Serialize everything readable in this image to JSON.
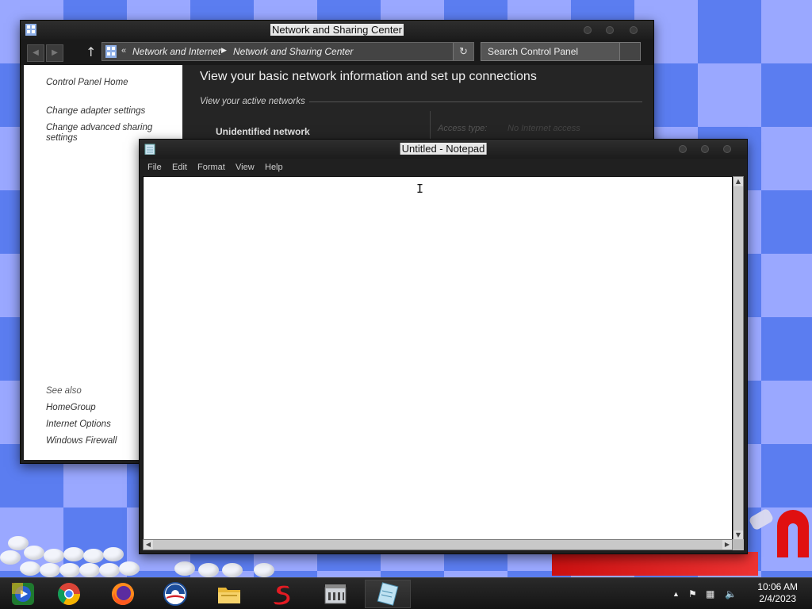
{
  "desktop": {},
  "network_window": {
    "title": "Network and Sharing Center",
    "address": {
      "crumb_prefix": "«",
      "crumb1": "Network and Internet",
      "crumb2": "Network and Sharing Center"
    },
    "search_placeholder": "Search Control Panel",
    "left_nav": {
      "home": "Control Panel Home",
      "adapter": "Change adapter settings",
      "advanced": "Change advanced sharing settings",
      "see_also": "See also",
      "homegroup": "HomeGroup",
      "internet_options": "Internet Options",
      "firewall": "Windows Firewall"
    },
    "heading": "View your basic network information and set up connections",
    "active_networks_label": "View your active networks",
    "network_name": "Unidentified network",
    "access_type_label": "Access type:",
    "access_type_value": "No Internet access"
  },
  "notepad": {
    "title": "Untitled - Notepad",
    "menu": [
      "File",
      "Edit",
      "Format",
      "View",
      "Help"
    ],
    "content": ""
  },
  "taskbar": {
    "apps": [
      {
        "name": "Windows Media Player"
      },
      {
        "name": "Google Chrome"
      },
      {
        "name": "Firefox"
      },
      {
        "name": "Obama Logo"
      },
      {
        "name": "File Explorer"
      },
      {
        "name": "S App"
      },
      {
        "name": "Control Panel"
      },
      {
        "name": "Notepad"
      }
    ],
    "clock": {
      "time": "10:06 AM",
      "date": "2/4/2023"
    }
  }
}
